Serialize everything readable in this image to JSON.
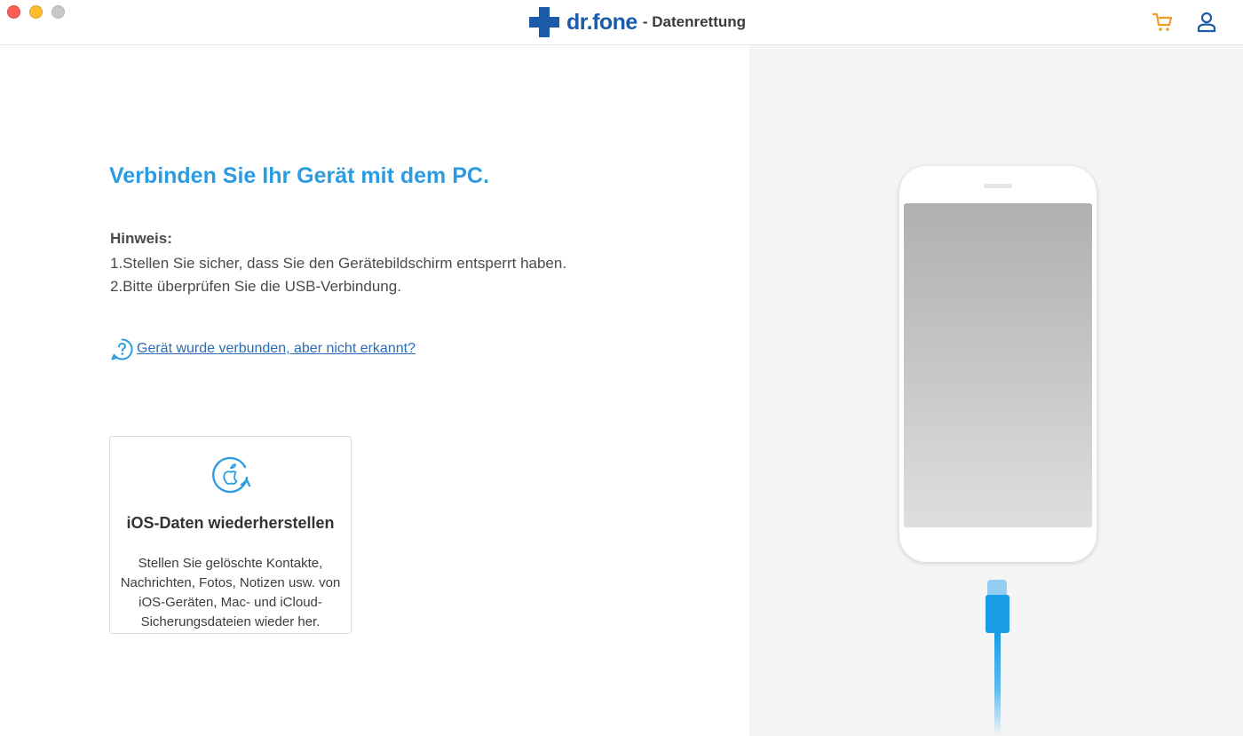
{
  "window": {
    "brand_name": "dr.fone",
    "brand_suffix": "- Datenrettung",
    "cart_icon": "shopping-cart-icon",
    "user_icon": "user-account-icon"
  },
  "main": {
    "heading": "Verbinden Sie Ihr Gerät mit dem PC.",
    "hint_title": "Hinweis:",
    "hint_lines": [
      "1.Stellen Sie sicher, dass Sie den Gerätebildschirm entsperrt haben.",
      "2.Bitte überprüfen Sie die USB-Verbindung."
    ],
    "help_link": "Gerät wurde verbunden, aber nicht erkannt?",
    "card": {
      "icon": "ios-restore-icon",
      "title": "iOS-Daten wiederherstellen",
      "description": "Stellen Sie gelöschte Kontakte, Nachrichten, Fotos, Notizen usw. von iOS-Geräten, Mac- und iCloud-Sicherungsdateien wieder her."
    }
  },
  "colors": {
    "accent_blue": "#2d9be0",
    "brand_blue": "#1d5aa8",
    "link_blue": "#2b6cb6",
    "cart_orange": "#f39c24",
    "cable_blue": "#1a9be6"
  }
}
